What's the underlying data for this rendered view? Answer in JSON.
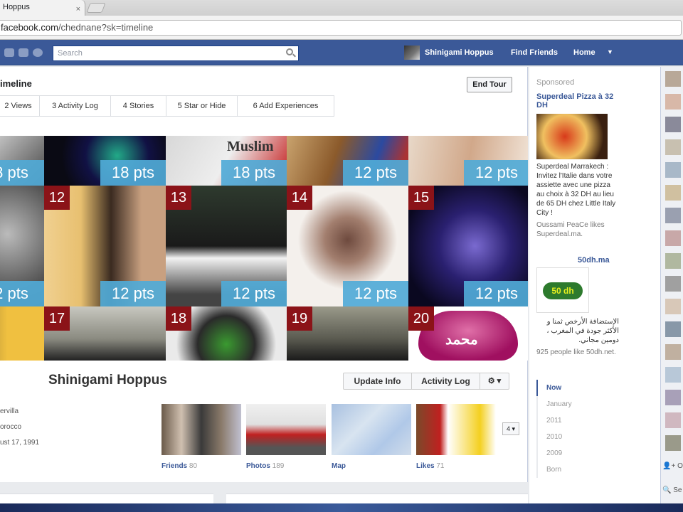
{
  "browser": {
    "tab_title": "Hoppus",
    "tab_close": "×",
    "url_host": "facebook.com",
    "url_path": "/chednane?sk=timeline"
  },
  "fb_header": {
    "search_placeholder": "Search",
    "user_name": "Shinigami Hoppus",
    "find_friends": "Find Friends",
    "home": "Home",
    "caret": "▼"
  },
  "tour": {
    "title": "imeline",
    "end_tour": "End Tour",
    "steps": [
      "2 Views",
      "3 Activity Log",
      "4 Stories",
      "5 Star or Hide",
      "6 Add Experiences"
    ]
  },
  "cover": {
    "row1": {
      "pts": [
        "8 pts",
        "18 pts",
        "18 pts",
        "12 pts",
        "12 pts"
      ],
      "words": [
        "Muslim"
      ]
    },
    "row2": {
      "nums": [
        "12",
        "13",
        "14",
        "15"
      ],
      "pts": [
        "2 pts",
        "12 pts",
        "12 pts",
        "12 pts",
        "12 pts"
      ]
    },
    "row3": {
      "nums": [
        "17",
        "18",
        "19",
        "20"
      ]
    },
    "heart_text": "محمد"
  },
  "profile": {
    "name": "Shinigami Hoppus",
    "update_info": "Update Info",
    "activity_log": "Activity Log",
    "gear": "⚙ ▾",
    "info_lines": [
      "ervilla",
      "orocco",
      "ust 17, 1991"
    ],
    "tiles": [
      {
        "label": "Friends",
        "count": "80"
      },
      {
        "label": "Photos",
        "count": "189"
      },
      {
        "label": "Map",
        "count": ""
      },
      {
        "label": "Likes",
        "count": "71"
      }
    ],
    "more": "4 ▾"
  },
  "sidebar": {
    "sponsored": "Sponsored",
    "ad1_title": "Superdeal Pizza à 32 DH",
    "ad1_text": "Superdeal Marrakech : Invitez l'Italie dans votre assiette avec une pizza au choix à 32 DH au lieu de 65 DH chez Little Italy City !",
    "ad1_social": "Oussami PeaCe likes Superdeal.ma.",
    "ad2_title": "50dh.ma",
    "ad2_logo": "50 dh",
    "ad2_text": "الإستضافة الأرخص ثمنا و الأكثر جودة في المغرب ، دومين مجاني.",
    "ad2_social": "925 people like 50dh.net.",
    "years": [
      "Now",
      "January",
      "2011",
      "2010",
      "2009",
      "Born"
    ]
  },
  "chat": {
    "status": "👤+ O",
    "search": "🔍 Se"
  },
  "colors": {
    "fb_blue": "#3b5998",
    "badge_red": "#8b1318",
    "pts_blue": "#50aad7"
  }
}
